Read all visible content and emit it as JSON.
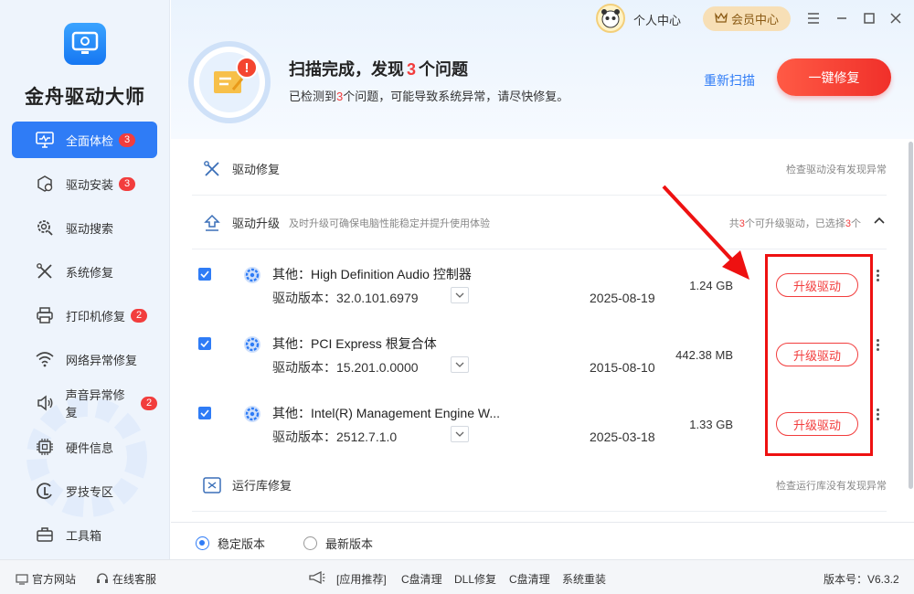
{
  "app": {
    "title": "金舟驱动大师"
  },
  "sidebar": {
    "items": [
      {
        "label": "全面体检",
        "badge": "3",
        "icon": "monitor-check-icon",
        "active": true
      },
      {
        "label": "驱动安装",
        "badge": "3",
        "icon": "package-gear-icon"
      },
      {
        "label": "驱动搜索",
        "badge": "",
        "icon": "gear-search-icon"
      },
      {
        "label": "系统修复",
        "badge": "",
        "icon": "wrench-screwdriver-icon"
      },
      {
        "label": "打印机修复",
        "badge": "2",
        "icon": "printer-icon"
      },
      {
        "label": "网络异常修复",
        "badge": "",
        "icon": "wifi-icon"
      },
      {
        "label": "声音异常修复",
        "badge": "2",
        "icon": "speaker-icon"
      },
      {
        "label": "硬件信息",
        "badge": "",
        "icon": "chip-icon"
      },
      {
        "label": "罗技专区",
        "badge": "",
        "icon": "logitech-icon"
      },
      {
        "label": "工具箱",
        "badge": "",
        "icon": "toolbox-icon"
      }
    ]
  },
  "topbar": {
    "user_center": "个人中心",
    "vip": "会员中心"
  },
  "header": {
    "title_prefix": "扫描完成，发现",
    "title_count": "3",
    "title_suffix": "个问题",
    "sub_prefix": "已检测到",
    "sub_count": "3",
    "sub_suffix": "个问题，可能导致系统异常，请尽快修复。",
    "rescan": "重新扫描",
    "fix_all": "一键修复"
  },
  "sections": {
    "driver_repair": {
      "title": "驱动修复",
      "status": "检查驱动没有发现异常"
    },
    "driver_upgrade": {
      "title": "驱动升级",
      "desc": "及时升级可确保电脑性能稳定并提升使用体验",
      "status_prefix": "共",
      "status_total": "3",
      "status_mid": "个可升级驱动，已选择",
      "status_selected": "3",
      "status_suffix": "个"
    },
    "runtime_repair": {
      "title": "运行库修复",
      "status": "检查运行库没有发现异常"
    }
  },
  "drivers": [
    {
      "name": "其他：High Definition Audio 控制器",
      "version": "驱动版本：32.0.101.6979",
      "date": "2025-08-19",
      "size": "1.24 GB",
      "action": "升级驱动",
      "checked": true
    },
    {
      "name": "其他：PCI Express 根复合体",
      "version": "驱动版本：15.201.0.0000",
      "date": "2015-08-10",
      "size": "442.38 MB",
      "action": "升级驱动",
      "checked": true
    },
    {
      "name": "其他：Intel(R) Management Engine W...",
      "version": "驱动版本：2512.7.1.0",
      "date": "2025-03-18",
      "size": "1.33 GB",
      "action": "升级驱动",
      "checked": true
    }
  ],
  "version_options": {
    "stable": "稳定版本",
    "latest": "最新版本",
    "selected": "stable"
  },
  "footer": {
    "website": "官方网站",
    "support": "在线客服",
    "links": [
      "[应用推荐]",
      "C盘清理",
      "DLL修复",
      "C盘清理",
      "系统重装"
    ],
    "version": "版本号：V6.3.2"
  },
  "colors": {
    "accent": "#2f7cf6",
    "danger": "#f23d3d",
    "sidebar_bg": "#eef4fc"
  }
}
